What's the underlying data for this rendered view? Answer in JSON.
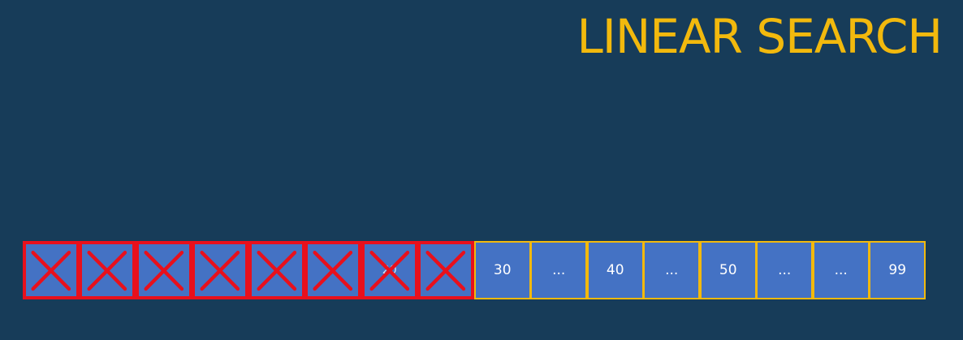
{
  "title": "LINEAR SEARCH",
  "colors": {
    "background": "#173c59",
    "title": "#f2b90d",
    "cell_fill": "#4472c4",
    "cell_border": "#f2b90d",
    "checked_border": "#e8101c",
    "cross": "#e8101c"
  },
  "array": {
    "cells": [
      {
        "value": "",
        "checked": true
      },
      {
        "value": "",
        "checked": true
      },
      {
        "value": "",
        "checked": true
      },
      {
        "value": "",
        "checked": true
      },
      {
        "value": "",
        "checked": true
      },
      {
        "value": "",
        "checked": true
      },
      {
        "value": "20",
        "checked": true
      },
      {
        "value": "",
        "checked": true
      },
      {
        "value": "30",
        "checked": false
      },
      {
        "value": "...",
        "checked": false
      },
      {
        "value": "40",
        "checked": false
      },
      {
        "value": "...",
        "checked": false
      },
      {
        "value": "50",
        "checked": false
      },
      {
        "value": "...",
        "checked": false
      },
      {
        "value": "...",
        "checked": false
      },
      {
        "value": "99",
        "checked": false
      }
    ]
  }
}
